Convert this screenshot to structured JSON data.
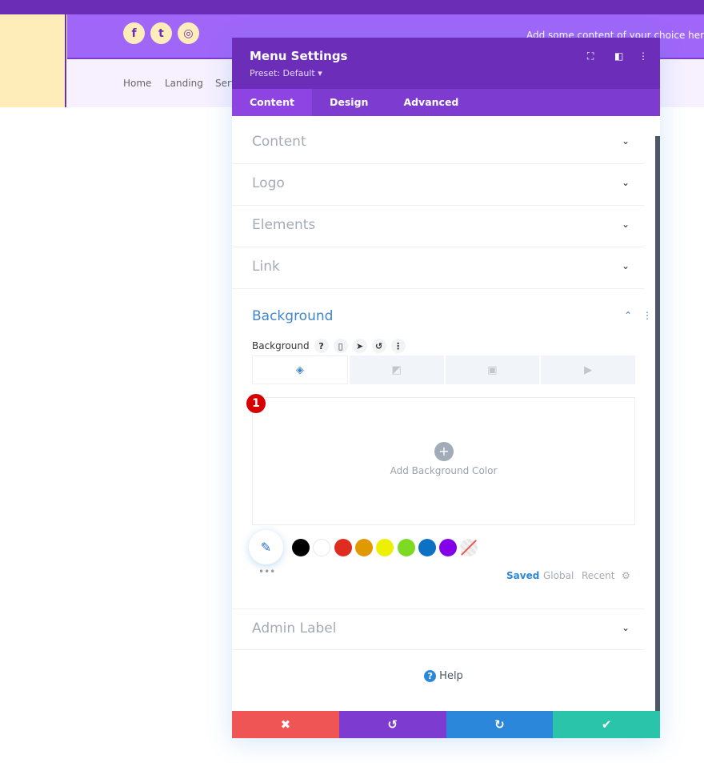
{
  "page": {
    "social": [
      "f",
      "t",
      "ig"
    ],
    "header_text": "Add some content of your choice here",
    "nav": [
      "Home",
      "Landing",
      "Serv"
    ]
  },
  "modal": {
    "title": "Menu Settings",
    "preset": "Preset: Default ▾",
    "tabs": [
      "Content",
      "Design",
      "Advanced"
    ],
    "sections": [
      "Content",
      "Logo",
      "Elements",
      "Link"
    ],
    "background": {
      "title": "Background",
      "label": "Background",
      "badge": "1",
      "add_label": "Add Background Color",
      "swatches": [
        "#000000",
        "#ffffff",
        "#e02b20",
        "#e09900",
        "#edf000",
        "#7cda24",
        "#0c71c3",
        "#8300e9"
      ],
      "palette_tabs": [
        "Saved",
        "Global",
        "Recent"
      ]
    },
    "admin_label": "Admin Label",
    "help": "Help"
  },
  "colors": {
    "primary": "#6c2eb9",
    "accent": "#2b87da",
    "cancel": "#ef5555",
    "undo": "#7e3bd0",
    "redo": "#2b87da",
    "save": "#29c4a9"
  }
}
